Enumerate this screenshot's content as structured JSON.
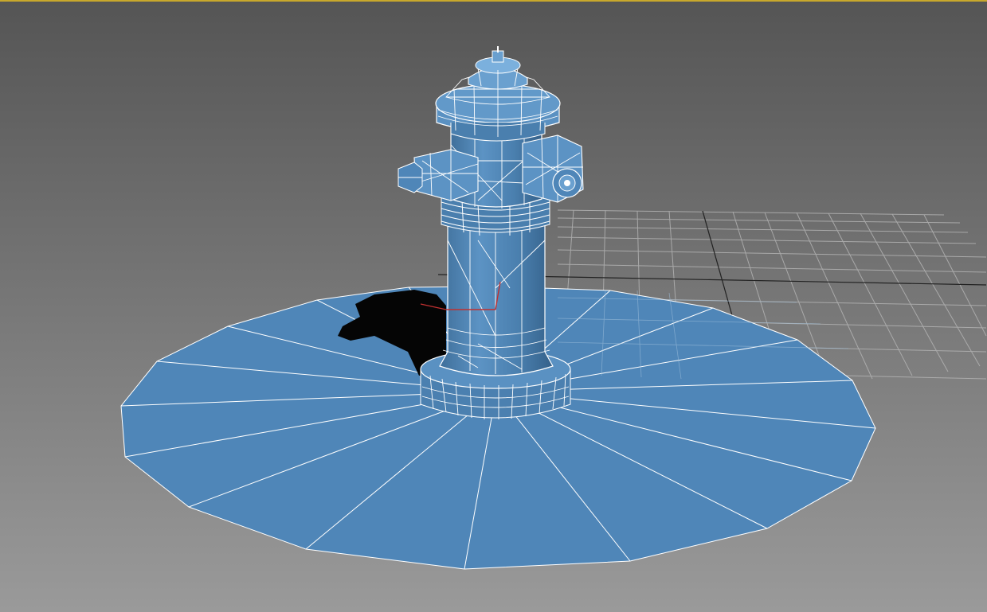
{
  "viewport": {
    "view": "perspective",
    "shading": "shaded-with-wireframe-edges",
    "active_border_color": "#c8a82c",
    "background_gradient": [
      "#555555",
      "#9a9a9a"
    ],
    "grid_visible": true
  },
  "scene": {
    "objects": [
      {
        "name": "fire-hydrant",
        "type": "mesh",
        "selected": true,
        "wire_color": "#ffffff",
        "surface_color": "#4f86b8"
      },
      {
        "name": "ground-disc",
        "type": "mesh",
        "segments": 22,
        "wire_color": "#ffffff",
        "surface_color": "#4f86b8"
      }
    ],
    "shadow": true,
    "pivot_gizmo_color": "#c03030"
  }
}
